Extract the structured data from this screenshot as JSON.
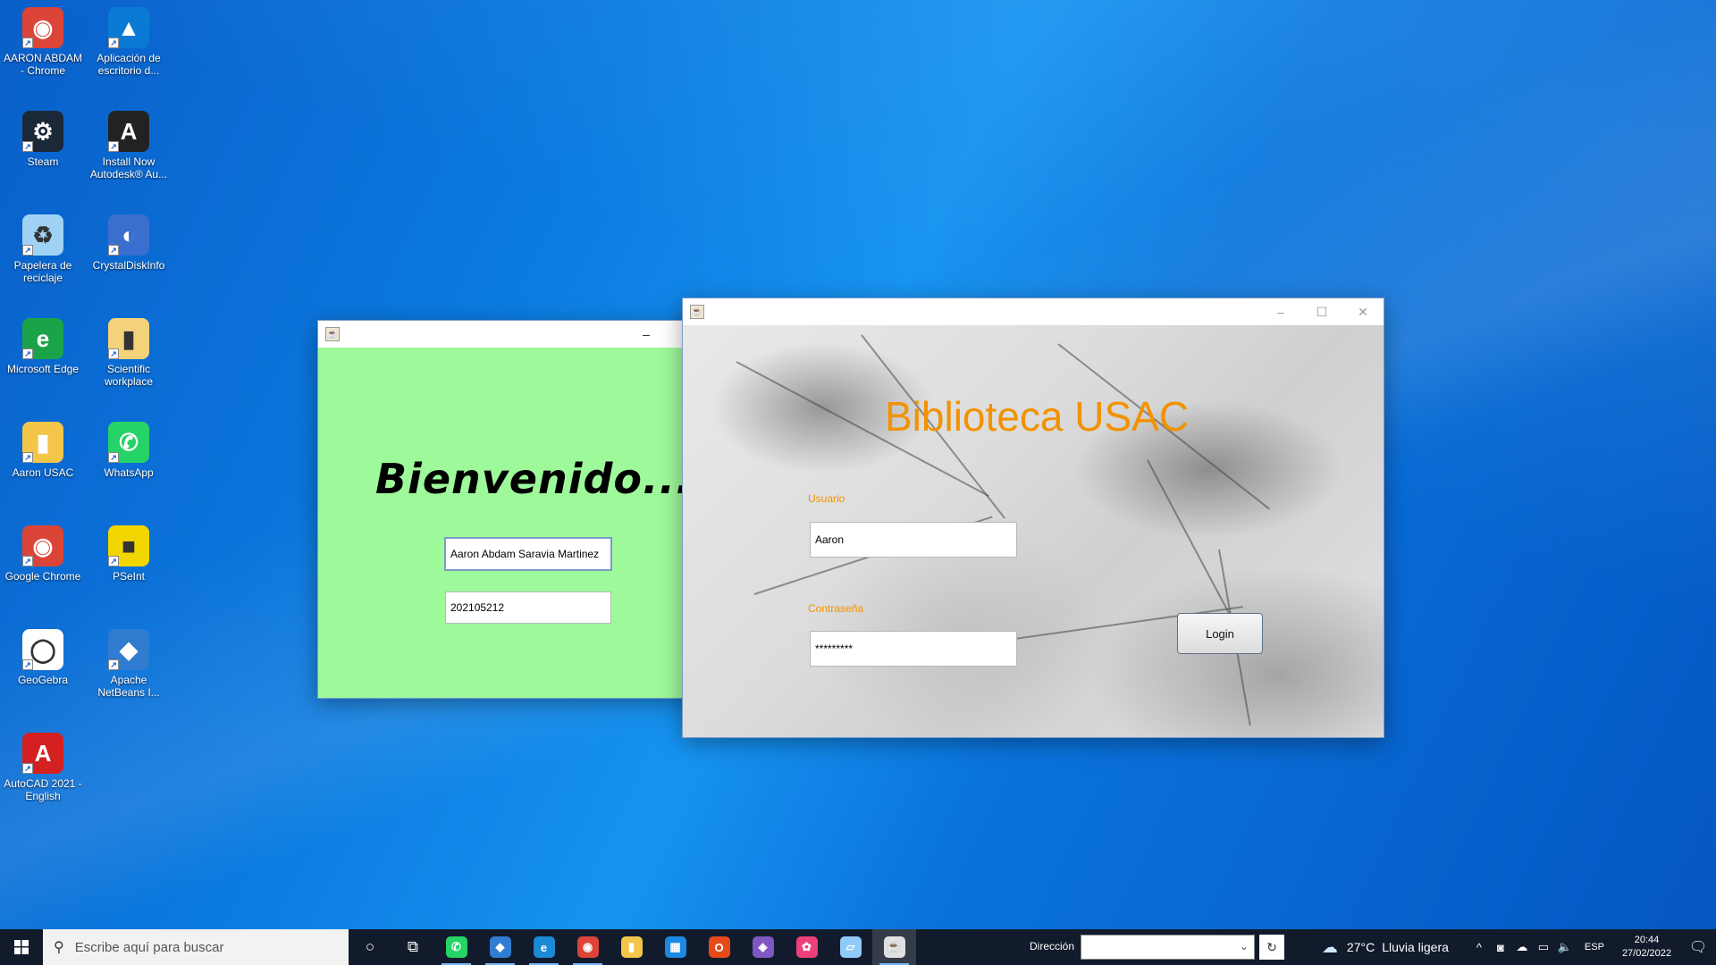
{
  "desktop": {
    "icons": [
      {
        "label": "AARON ABDAM - Chrome",
        "icon": "chrome-icon",
        "color": "#db4437"
      },
      {
        "label": "Aplicación de escritorio d...",
        "icon": "azure-data-studio-icon",
        "color": "#0a7ad4"
      },
      {
        "label": "Steam",
        "icon": "steam-icon",
        "color": "#1b2838"
      },
      {
        "label": "Install Now Autodesk® Au...",
        "icon": "autodesk-icon",
        "color": "#222222"
      },
      {
        "label": "Papelera de reciclaje",
        "icon": "recycle-bin-icon",
        "color": "#9fd2f5"
      },
      {
        "label": "CrystalDiskInfo",
        "icon": "crystaldiskinfo-icon",
        "color": "#3a6fd0"
      },
      {
        "label": "Microsoft Edge",
        "icon": "edge-icon",
        "color": "#1ba34a"
      },
      {
        "label": "Scientific workplace",
        "icon": "folder-icon",
        "color": "#f3d27a"
      },
      {
        "label": "Aaron USAC",
        "icon": "folder-icon",
        "color": "#f3c64a"
      },
      {
        "label": "WhatsApp",
        "icon": "whatsapp-icon",
        "color": "#25d366"
      },
      {
        "label": "Google Chrome",
        "icon": "chrome-icon",
        "color": "#db4437"
      },
      {
        "label": "PSeInt",
        "icon": "pseint-icon",
        "color": "#f2d600"
      },
      {
        "label": "GeoGebra",
        "icon": "geogebra-icon",
        "color": "#ffffff"
      },
      {
        "label": "Apache NetBeans I...",
        "icon": "netbeans-icon",
        "color": "#2f7cd0"
      },
      {
        "label": "AutoCAD 2021 - English",
        "icon": "autocad-icon",
        "color": "#d42020"
      }
    ]
  },
  "welcome_window": {
    "heading": "Bienvenido......",
    "name_value": "Aaron Abdam Saravia Martinez",
    "id_value": "202105212",
    "controls": {
      "minimize": "–",
      "maximize": "☐",
      "close": "✕"
    }
  },
  "login_window": {
    "title": "Biblioteca USAC",
    "user_label": "Usuario",
    "user_value": "Aaron",
    "password_label": "Contraseña",
    "password_value": "*********",
    "login_button": "Login",
    "controls": {
      "minimize": "–",
      "maximize": "☐",
      "close": "✕"
    }
  },
  "taskbar": {
    "search_placeholder": "Escribe aquí para buscar",
    "address_label": "Dirección",
    "address_value": "",
    "weather_temp": "27°C",
    "weather_desc": "Lluvia ligera",
    "language": "ESP",
    "time": "20:44",
    "date": "27/02/2022",
    "apps": [
      {
        "name": "whatsapp",
        "color": "#25d366"
      },
      {
        "name": "netbeans",
        "color": "#2f7cd0"
      },
      {
        "name": "edge",
        "color": "#1b8ad4"
      },
      {
        "name": "chrome",
        "color": "#db4437"
      },
      {
        "name": "file-explorer",
        "color": "#f3c64a"
      },
      {
        "name": "store",
        "color": "#1e88e5"
      },
      {
        "name": "office",
        "color": "#e64a19"
      },
      {
        "name": "visual-studio",
        "color": "#7e57c2"
      },
      {
        "name": "paint",
        "color": "#ec407a"
      },
      {
        "name": "notes",
        "color": "#90caf9"
      },
      {
        "name": "java",
        "color": "#e0e0e0"
      }
    ]
  }
}
